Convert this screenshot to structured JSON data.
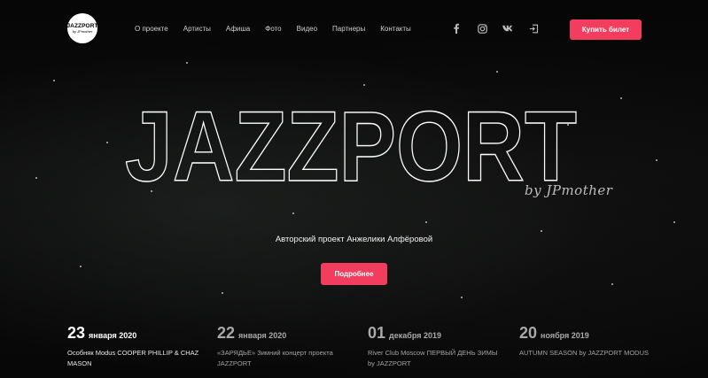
{
  "header": {
    "logo": {
      "line1": "JAZZPORT",
      "line2": "by JPmother"
    },
    "nav": [
      "О проекте",
      "Артисты",
      "Афиша",
      "Фото",
      "Видео",
      "Партнеры",
      "Контакты"
    ],
    "socials": [
      "facebook-icon",
      "instagram-icon",
      "vk-icon",
      "login-icon"
    ],
    "buy_label": "Купить билет"
  },
  "hero": {
    "title": "JAZZPORT",
    "byline": "by JPmother",
    "subtitle": "Авторский проект Анжелики Алфёровой",
    "more_label": "Подробнее"
  },
  "events": [
    {
      "day": "23",
      "month": "января 2020",
      "desc": "Особняк Modus COOPER PHILLIP & CHAZ MASON"
    },
    {
      "day": "22",
      "month": "января 2020",
      "desc": "«ЗАРЯДЬЕ» Зимний концерт проекта JAZZPORT"
    },
    {
      "day": "01",
      "month": "декабря 2019",
      "desc": "River Club Moscow ПЕРВЫЙ ДЕНЬ ЗИМЫ by JAZZPORT"
    },
    {
      "day": "20",
      "month": "ноября 2019",
      "desc": "AUTUMN SEASON by JAZZPORT MODUS"
    }
  ],
  "colors": {
    "accent": "#f23d5e",
    "background": "#050505"
  }
}
